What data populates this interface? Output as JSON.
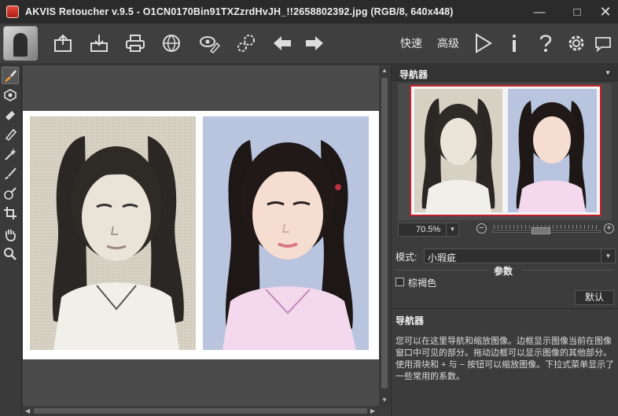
{
  "window": {
    "title": "AKVIS Retoucher v.9.5 - O1CN0170Bin91TXZzrdHvJH_!!2658802392.jpg (RGB/8, 640x448)",
    "controls": [
      "minimize-icon",
      "maximize-icon",
      "close-icon"
    ]
  },
  "toolbar": {
    "icons": [
      "open-image-icon",
      "save-image-icon",
      "print-icon",
      "publish-icon",
      "batch-processing-icon",
      "preferences-gear-icon",
      "undo-arrow-icon",
      "redo-arrow-icon",
      "run-play-icon",
      "info-icon",
      "help-icon",
      "settings-gear-icon",
      "speech-bubble-icon"
    ],
    "quick_label": "快速",
    "advanced_label": "高级"
  },
  "tools": [
    "colorize-brush-icon",
    "retouch-stamp-icon",
    "eraser-icon",
    "erase-tool-icon",
    "magic-wand-icon",
    "brush-icon",
    "healing-brush-icon",
    "crop-icon",
    "hand-icon",
    "zoom-icon"
  ],
  "navigator": {
    "title": "导航器",
    "zoom_value": "70.5%",
    "minus_label": "−",
    "plus_label": "+"
  },
  "settings": {
    "mode_label": "模式:",
    "mode_value": "小瑕疵",
    "params_title": "参数",
    "checkbox_label": "棕褐色",
    "default_button": "默认"
  },
  "help": {
    "title": "导航器",
    "text": "您可以在这里导航和缩放图像。边框显示图像当前在图像窗口中可见的部分。拖动边框可以显示图像的其他部分。使用滑块和 + 与 − 按钮可以缩放图像。下拉式菜单显示了一些常用的系数。"
  },
  "colors": {
    "background": "#3c3c3c",
    "titlebar": "#2b2b2b",
    "nav_frame": "#c0202a",
    "bw_photo_bg": "#d8d3c6",
    "color_photo_bg": "#b8c3dc"
  }
}
